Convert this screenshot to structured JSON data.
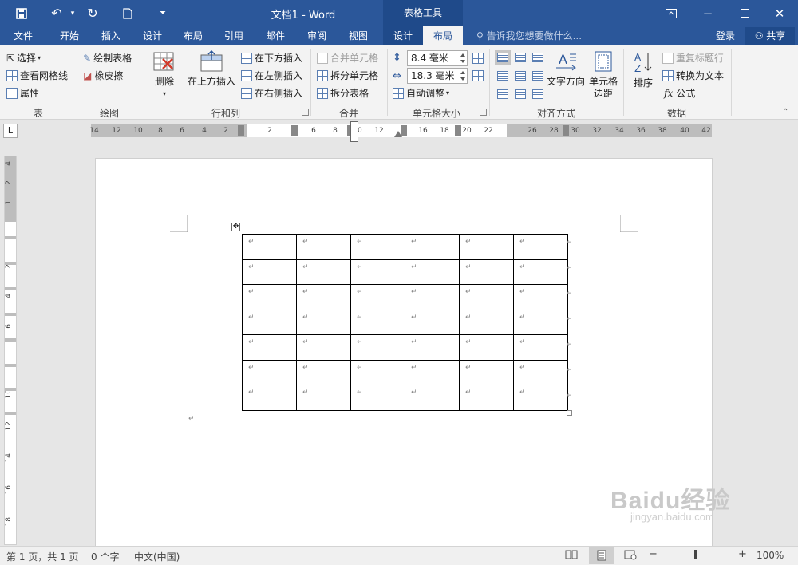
{
  "window": {
    "title": "文档1 - Word",
    "context_tools": "表格工具",
    "buttons": [
      "restore-ribbon",
      "minimize",
      "maximize",
      "close"
    ]
  },
  "quick_access": {
    "icons": [
      "save-icon",
      "undo-icon",
      "redo-icon",
      "new-doc-icon",
      "customize-icon"
    ]
  },
  "tabs": {
    "file": "文件",
    "home": "开始",
    "insert": "插入",
    "design": "设计",
    "layout": "布局",
    "references": "引用",
    "mailings": "邮件",
    "review": "审阅",
    "view": "视图",
    "table_design": "设计",
    "table_layout": "布局"
  },
  "tell_me": "告诉我您想要做什么...",
  "login": "登录",
  "share": "共享",
  "ribbon": {
    "table": {
      "select": "选择",
      "view_gridlines": "查看网格线",
      "properties": "属性",
      "group": "表"
    },
    "draw": {
      "draw_table": "绘制表格",
      "eraser": "橡皮擦",
      "group": "绘图"
    },
    "rows_cols": {
      "delete": "删除",
      "insert_above": "在上方插入",
      "insert_below": "在下方插入",
      "insert_left": "在左侧插入",
      "insert_right": "在右侧插入",
      "group": "行和列"
    },
    "merge": {
      "merge_cells": "合并单元格",
      "split_cells": "拆分单元格",
      "split_table": "拆分表格",
      "group": "合并"
    },
    "cell_size": {
      "height": "8.4 毫米",
      "width": "18.3 毫米",
      "autofit": "自动调整",
      "group": "单元格大小"
    },
    "alignment": {
      "text_direction": "文字方向",
      "cell_margins_1": "单元格",
      "cell_margins_2": "边距",
      "group": "对齐方式"
    },
    "data": {
      "sort": "排序",
      "repeat_header": "重复标题行",
      "convert_to_text": "转换为文本",
      "formula": "公式",
      "fx": "fx",
      "group": "数据"
    }
  },
  "ruler": {
    "corner": "L",
    "h_numbers": [
      "14",
      "12",
      "10",
      "8",
      "6",
      "4",
      "2",
      "2",
      "6",
      "8",
      "10",
      "12",
      "16",
      "18",
      "20",
      "22",
      "26",
      "28",
      "30",
      "32",
      "34",
      "36",
      "38",
      "40",
      "42"
    ],
    "v_numbers": [
      "4",
      "2",
      "1",
      "2",
      "4",
      "6",
      "10",
      "12",
      "14",
      "16",
      "18"
    ]
  },
  "document": {
    "table": {
      "rows": 7,
      "cols": 6,
      "cell_mark": "↵"
    },
    "paragraph_mark": "↵"
  },
  "status": {
    "page": "第 1 页，共 1 页",
    "words": "0 个字",
    "language": "中文(中国)",
    "zoom": "100%"
  },
  "watermark": {
    "text": "Baidu经验",
    "url": "jingyan.baidu.com"
  }
}
